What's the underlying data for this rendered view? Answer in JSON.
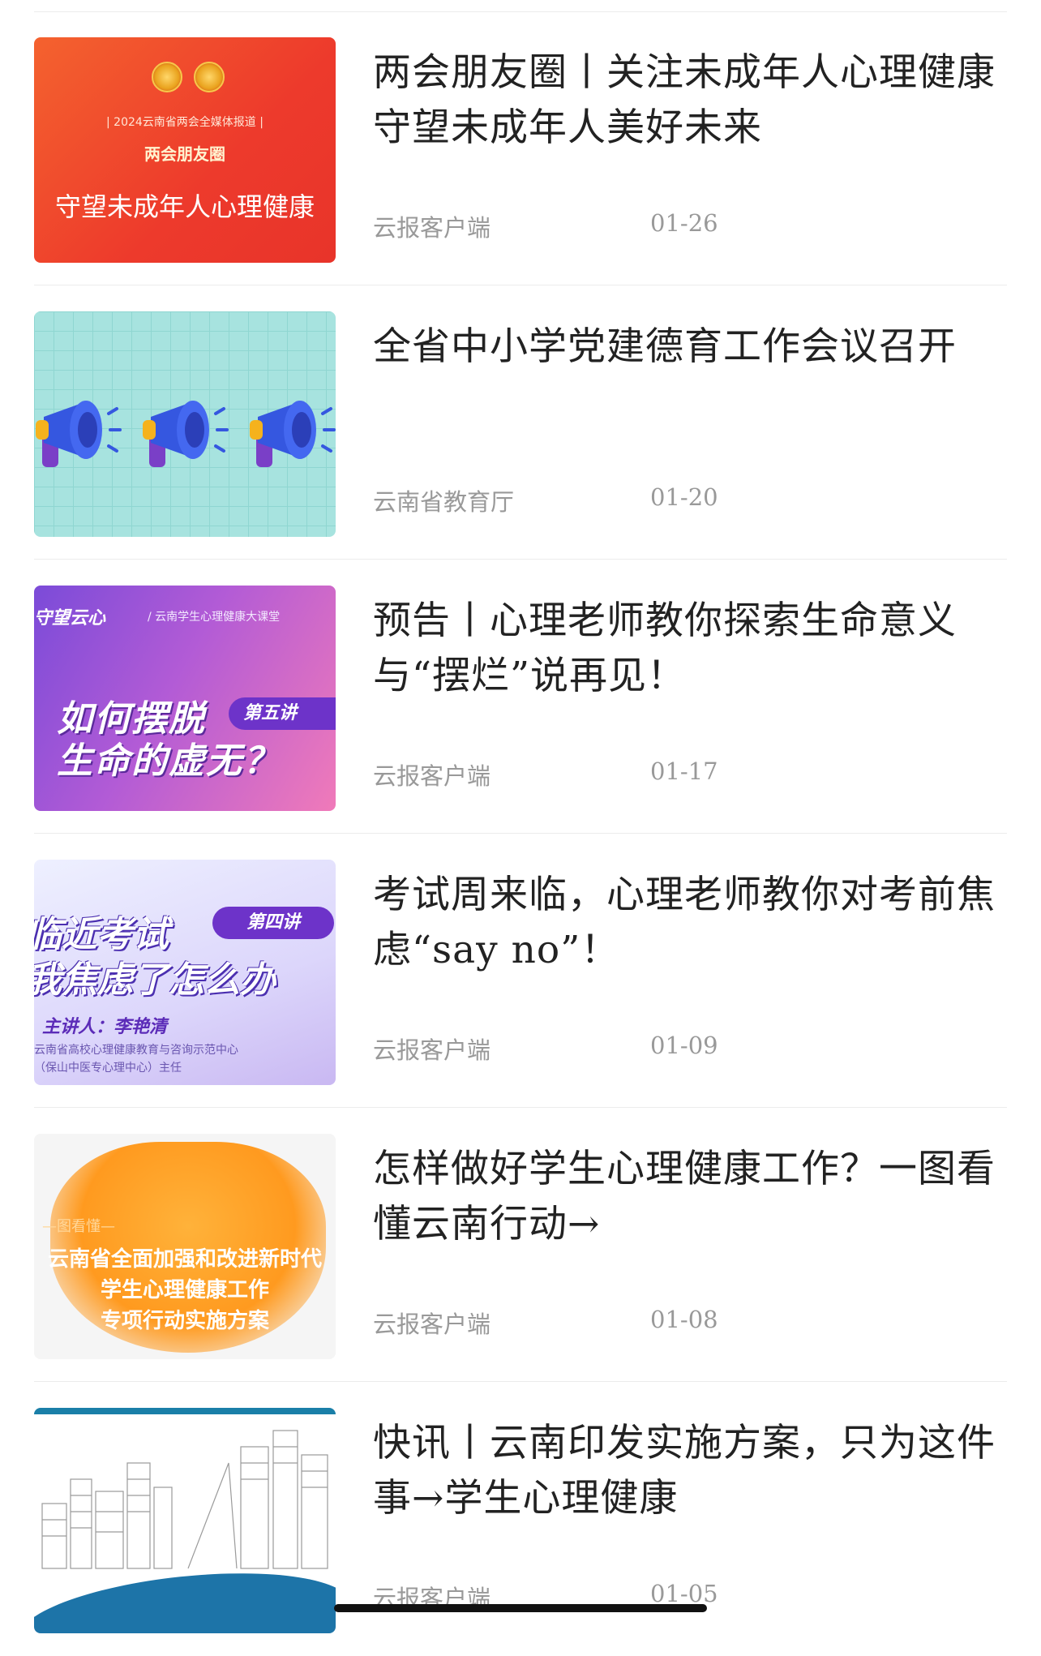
{
  "articles": [
    {
      "title": "两会朋友圈丨关注未成年人心理健康 守望未成年人美好未来",
      "source": "云报客户端",
      "date": "01-26",
      "thumb": {
        "subtitle": "| 2024云南省两会全媒体报道 |",
        "heading": "两会朋友圈",
        "text": "守望未成年人心理健康"
      }
    },
    {
      "title": "全省中小学党建德育工作会议召开",
      "source": "云南省教育厅",
      "date": "01-20",
      "thumb": {
        "icon": "megaphone-icon"
      }
    },
    {
      "title": "预告丨心理老师教你探索生命意义 与“摆烂”说再见！",
      "source": "云报客户端",
      "date": "01-17",
      "thumb": {
        "tag": "守望云心",
        "series": "/ 云南学生心理健康大课堂",
        "line1": "如何摆脱",
        "line2": "生命的虚无？",
        "badge": "第五讲"
      }
    },
    {
      "title": "考试周来临，心理老师教你对考前焦虑“say no”！",
      "source": "云报客户端",
      "date": "01-09",
      "thumb": {
        "line1": "临近考试",
        "line2": "我焦虑了怎么办",
        "badge": "第四讲",
        "speaker": "主讲人：李艳清",
        "org1": "云南省高校心理健康教育与咨询示范中心",
        "org2": "（保山中医专心理中心）主任"
      }
    },
    {
      "title": "怎样做好学生心理健康工作？一图看懂云南行动→",
      "source": "云报客户端",
      "date": "01-08",
      "thumb": {
        "kicker": "—图看懂—",
        "line1": "云南省全面加强和改进新时代",
        "line2": "学生心理健康工作",
        "line3": "专项行动实施方案"
      }
    },
    {
      "title": "快讯丨云南印发实施方案，只为这件事→学生心理健康",
      "source": "云报客户端",
      "date": "01-05",
      "thumb": {
        "icon": "city-skyline-icon"
      }
    }
  ]
}
